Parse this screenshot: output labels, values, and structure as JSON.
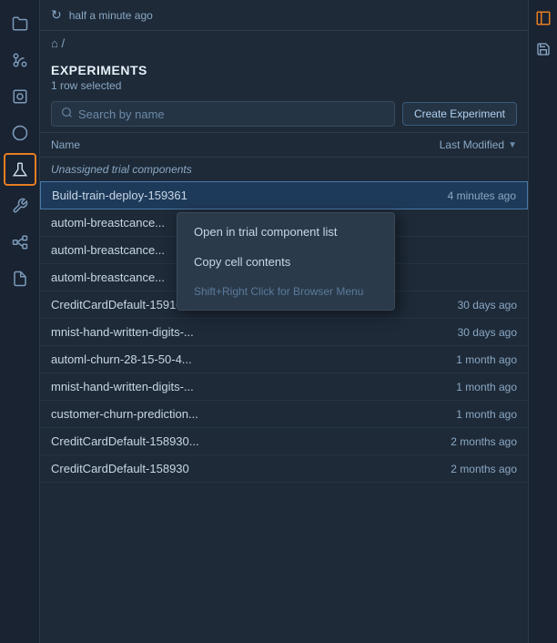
{
  "topbar": {
    "time_label": "half a minute ago",
    "refresh_icon": "↻"
  },
  "breadcrumb": {
    "home_icon": "⌂",
    "separator": "/"
  },
  "experiments": {
    "title": "EXPERIMENTS",
    "row_selected": "1 row selected",
    "search_placeholder": "Search by name",
    "create_button_label": "Create Experiment"
  },
  "table": {
    "col_name": "Name",
    "col_modified": "Last Modified",
    "section_label": "Unassigned trial components",
    "rows": [
      {
        "name": "Build-train-deploy-159361",
        "time": "4 minutes ago",
        "selected": true
      },
      {
        "name": "automl-breastcance...",
        "time": "",
        "selected": false
      },
      {
        "name": "automl-breastcance...",
        "time": "",
        "selected": false
      },
      {
        "name": "automl-breastcance...",
        "time": "",
        "selected": false
      },
      {
        "name": "CreditCardDefault-159103...",
        "time": "30 days ago",
        "selected": false
      },
      {
        "name": "mnist-hand-written-digits-...",
        "time": "30 days ago",
        "selected": false
      },
      {
        "name": "automl-churn-28-15-50-4...",
        "time": "1 month ago",
        "selected": false
      },
      {
        "name": "mnist-hand-written-digits-...",
        "time": "1 month ago",
        "selected": false
      },
      {
        "name": "customer-churn-prediction...",
        "time": "1 month ago",
        "selected": false
      },
      {
        "name": "CreditCardDefault-158930...",
        "time": "2 months ago",
        "selected": false
      },
      {
        "name": "CreditCardDefault-158930",
        "time": "2 months ago",
        "selected": false
      }
    ]
  },
  "context_menu": {
    "items": [
      {
        "label": "Open in trial component list",
        "disabled": false
      },
      {
        "label": "Copy cell contents",
        "disabled": false
      },
      {
        "label": "Shift+Right Click for Browser Menu",
        "disabled": true
      }
    ]
  },
  "sidebar": {
    "icons": [
      {
        "name": "folder-icon",
        "symbol": "🗂",
        "active": false
      },
      {
        "name": "git-icon",
        "symbol": "⎇",
        "active": false
      },
      {
        "name": "docker-icon",
        "symbol": "◉",
        "active": false
      },
      {
        "name": "palette-icon",
        "symbol": "🎨",
        "active": false
      },
      {
        "name": "flask-icon",
        "symbol": "⚗",
        "active": true
      },
      {
        "name": "wrench-icon",
        "symbol": "🔧",
        "active": false
      },
      {
        "name": "network-icon",
        "symbol": "⬡",
        "active": false
      },
      {
        "name": "file-icon",
        "symbol": "📄",
        "active": false
      }
    ]
  },
  "right_panel": {
    "tab_icon": "▣",
    "save_icon": "💾"
  }
}
